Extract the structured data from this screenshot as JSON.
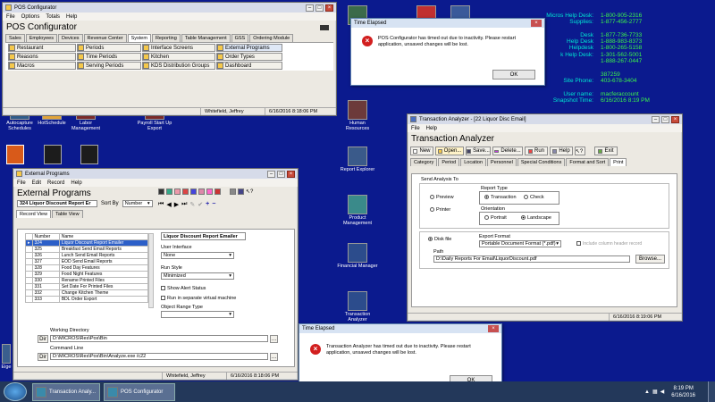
{
  "pos": {
    "title": "POS Configurator",
    "menu": [
      "File",
      "Options",
      "Totals",
      "Help"
    ],
    "heading": "POS Configurator",
    "tabs": [
      "Sales",
      "Employees",
      "Devices",
      "Revenue Center",
      "System",
      "Reporting",
      "Table Management",
      "GSS",
      "Ordering Module"
    ],
    "buttons": [
      "Restaurant",
      "Periods",
      "Interface Screens",
      "External Programs",
      "Reasons",
      "Time Periods",
      "Kitchen",
      "Order Types",
      "Macros",
      "Serving Periods",
      "KDS Distribution Groups",
      "Dashboard"
    ],
    "status_user": "Whitefield, Jeffrey",
    "status_time": "6/16/2016 8:18:06 PM"
  },
  "desktop_icons": [
    {
      "label": "Autocapture Schedules"
    },
    {
      "label": "HotSchedule"
    },
    {
      "label": "Labor Management"
    },
    {
      "label": "Payroll Start Up Export"
    },
    {
      "label": "Human Resources"
    },
    {
      "label": "Report Explorer"
    },
    {
      "label": "Product Management"
    },
    {
      "label": "Financial Manager"
    },
    {
      "label": "Transaction Analyzer"
    },
    {
      "label": "Eige"
    }
  ],
  "info": {
    "lines": [
      {
        "label": "Micros Help Desk:",
        "value": "1-800-905-2316"
      },
      {
        "label": "Supplies:",
        "value": "1-877-456-2777"
      },
      {
        "label": "",
        "value": ""
      },
      {
        "label": "Desk",
        "value": "1-877-736-7733"
      },
      {
        "label": "Help Desk",
        "value": "1-888-983-8373"
      },
      {
        "label": "Helpdesk",
        "value": "1-800-265-5158"
      },
      {
        "label": "k Help Desk:",
        "value": "1-301-562-5001"
      },
      {
        "label": "",
        "value": "1-888-267-0447"
      },
      {
        "label": "",
        "value": ""
      },
      {
        "label": "",
        "value": "387259"
      },
      {
        "label": "Site Phone:",
        "value": "403-678-3404"
      },
      {
        "label": "",
        "value": ""
      },
      {
        "label": "User name:",
        "value": "macferaccount"
      },
      {
        "label": "Snapshot Time:",
        "value": "6/16/2016 8:19 PM"
      }
    ]
  },
  "dialog1": {
    "title": "Time Elapsed",
    "message": "POS Configurator has timed out due to inactivity. Please restart application, unsaved changes will be lost.",
    "ok": "OK"
  },
  "dialog2": {
    "title": "Time Elapsed",
    "message": "Transaction Analyzer has timed out due to inactivity. Please restart application, unsaved changes will be lost.",
    "ok": "OK"
  },
  "ta": {
    "title": "Transaction Analyzer - [22 Liquor Disc Email]",
    "menu": [
      "File",
      "Help"
    ],
    "heading": "Transaction Analyzer",
    "toolbar": [
      "New",
      "Open...",
      "Save...",
      "Delete...",
      "Run",
      "Help",
      "",
      "Exit"
    ],
    "tabs": [
      "Category",
      "Period",
      "Location",
      "Personnel",
      "Special Conditions",
      "Format and Sort",
      "Print"
    ],
    "send_to": "Send Analysis To",
    "preview": "Preview",
    "printer": "Printer",
    "report_type": "Report Type",
    "transaction": "Transaction",
    "check": "Check",
    "orientation": "Orientation",
    "portrait": "Portrait",
    "landscape": "Landscape",
    "disk_file": "Disk file",
    "export_format": "Export Format",
    "export_value": "Portable Document Format (*.pdf)",
    "include_header": "Include column header record",
    "path_label": "Path",
    "path_value": "D:\\Daily Reports For Email\\LiquorDiscount.pdf",
    "browse": "Browse...",
    "status_time": "6/16/2016 8:19:06 PM"
  },
  "ep": {
    "title": "External Programs",
    "menu": [
      "File",
      "Edit",
      "Record",
      "Help"
    ],
    "heading": "External Programs",
    "record": "324 Liquor Discount Report Er",
    "sort_by_label": "Sort By",
    "sort_by_value": "Number",
    "tabs": [
      "Record View",
      "Table View"
    ],
    "columns": [
      "Number",
      "Name"
    ],
    "rows": [
      {
        "num": "324",
        "name": "Liquor Discount Report Emailer"
      },
      {
        "num": "325",
        "name": "Breakfast Send Email Reports"
      },
      {
        "num": "326",
        "name": "Lunch Send Email Reports"
      },
      {
        "num": "327",
        "name": "EOD Send Email Reports"
      },
      {
        "num": "328",
        "name": "Food Day Features"
      },
      {
        "num": "329",
        "name": "Food Night Features"
      },
      {
        "num": "330",
        "name": "Rename Printed Files"
      },
      {
        "num": "331",
        "name": "Set Date For Printed Files"
      },
      {
        "num": "332",
        "name": "Change Kitchen Theme"
      },
      {
        "num": "333",
        "name": "BDL Order Export"
      }
    ],
    "detail_title": "Liquor Discount Report Emailer",
    "ui_label": "User Interface",
    "ui_value": "None",
    "run_label": "Run Style",
    "run_value": "Minimized",
    "show_alert": "Show Alert Status",
    "run_virtual": "Run in separate virtual machine",
    "range_label": "Object Range Type",
    "wd_label": "Working Directory",
    "wd_value": "D:\\MICROS\\Res\\Pos\\Bin",
    "cmd_label": "Command Line",
    "cmd_value": "D:\\MICROS\\Res\\Pos\\Bin\\Analyze.exe /c22",
    "dir_btn": "Dir",
    "status_user": "Whitefield, Jeffrey",
    "status_time": "6/16/2016 8:18:06 PM"
  },
  "taskbar": {
    "items": [
      "Transaction Analy...",
      "POS Configurator"
    ],
    "time": "8:19 PM",
    "date": "6/16/2016"
  }
}
